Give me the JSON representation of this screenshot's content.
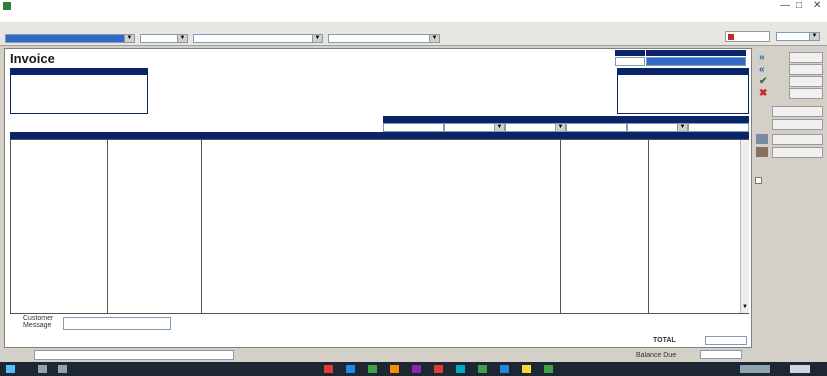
{
  "window": {
    "title": "",
    "controls": [
      "—",
      "□",
      "✕"
    ]
  },
  "menubar": {
    "items": [
      "",
      "",
      "",
      "",
      "",
      "",
      "",
      "",
      ""
    ]
  },
  "toolbar": {
    "customer_job_label": "",
    "customer_job_value": "",
    "class_label": "",
    "class_value": "",
    "account_label": "",
    "account_value": "",
    "template_label": "",
    "template_value": "",
    "navigator_label": "",
    "search_value": ""
  },
  "invoice": {
    "heading": "Invoice",
    "date_header": "",
    "date_value": "",
    "invoice_no_header": "",
    "invoice_no_value": "",
    "bill_to_header": "",
    "bill_to_lines": [
      ""
    ],
    "ship_to_header": "",
    "po_fields": [
      {
        "header": "",
        "value": ""
      },
      {
        "header": "",
        "value": ""
      },
      {
        "header": "",
        "value": ""
      },
      {
        "header": "",
        "value": ""
      },
      {
        "header": "",
        "value": ""
      },
      {
        "header": "",
        "value": ""
      }
    ],
    "columns": [
      "",
      "",
      "",
      "",
      ""
    ],
    "line_items": [
      {
        "qty": "",
        "item": "",
        "description": "",
        "rate": "",
        "amount": ""
      },
      {
        "qty": "",
        "item": "",
        "description": "",
        "rate": "",
        "amount": ""
      },
      {
        "qty": "",
        "item": "",
        "description": "",
        "rate": "",
        "amount": ""
      }
    ],
    "customer_message_label": "Customer Message",
    "total_label": "TOTAL",
    "total_value": "",
    "balance_due_label": "Balance Due",
    "balance_due_value": "",
    "memo_label": ""
  },
  "side_panel": {
    "next_label": "",
    "prev_label": "",
    "ok_label": "",
    "cancel_label": "",
    "payment_history_label": "",
    "time_costs_label": "",
    "process_label": "",
    "print_label": "",
    "checkbox_label": ""
  },
  "colors": {
    "header_blue": "#0a246a",
    "form_bg": "#ffffff",
    "chrome": "#d4d0c8",
    "taskbar": "#1c2733"
  }
}
